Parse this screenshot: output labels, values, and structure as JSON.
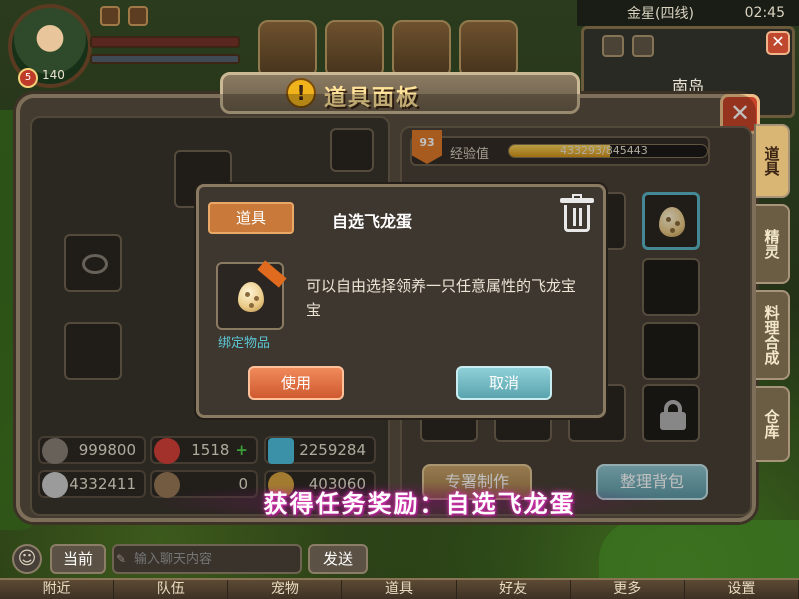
{
  "hud": {
    "level": "140",
    "server": "金星(四线)",
    "time": "02:45",
    "map_name": "南岛"
  },
  "panel": {
    "title": "道具面板",
    "level_badge": "93",
    "exp_label": "经验值",
    "exp_text": "433293/845443",
    "exp_progress": 0.51,
    "side_tabs": [
      "道具",
      "精灵",
      "料理合成",
      "仓库"
    ],
    "make_button": "专署制作",
    "sort_button": "整理背包",
    "stats": {
      "stars": "999800",
      "hearts": "1518",
      "diamonds": "2259284",
      "coins": "4332411",
      "axes": "0",
      "gold": "403060"
    }
  },
  "dialog": {
    "tab_label": "道具",
    "item_name": "自选飞龙蛋",
    "description": "可以自由选择领养一只任意属性的飞龙宝宝",
    "bound_label": "绑定物品",
    "use_button": "使用",
    "cancel_button": "取消"
  },
  "banner": {
    "text": "获得任务奖励：自选飞龙蛋"
  },
  "chat": {
    "channel": "当前",
    "placeholder": "输入聊天内容",
    "send": "发送"
  },
  "bottom_nav": [
    "附近",
    "队伍",
    "宠物",
    "道具",
    "好友",
    "更多",
    "设置"
  ],
  "colors": {
    "accent_orange": "#cf5a30",
    "accent_teal": "#5aa4ae",
    "banner_glow": "#e03ab8",
    "exp_fill": "#d5941a"
  }
}
